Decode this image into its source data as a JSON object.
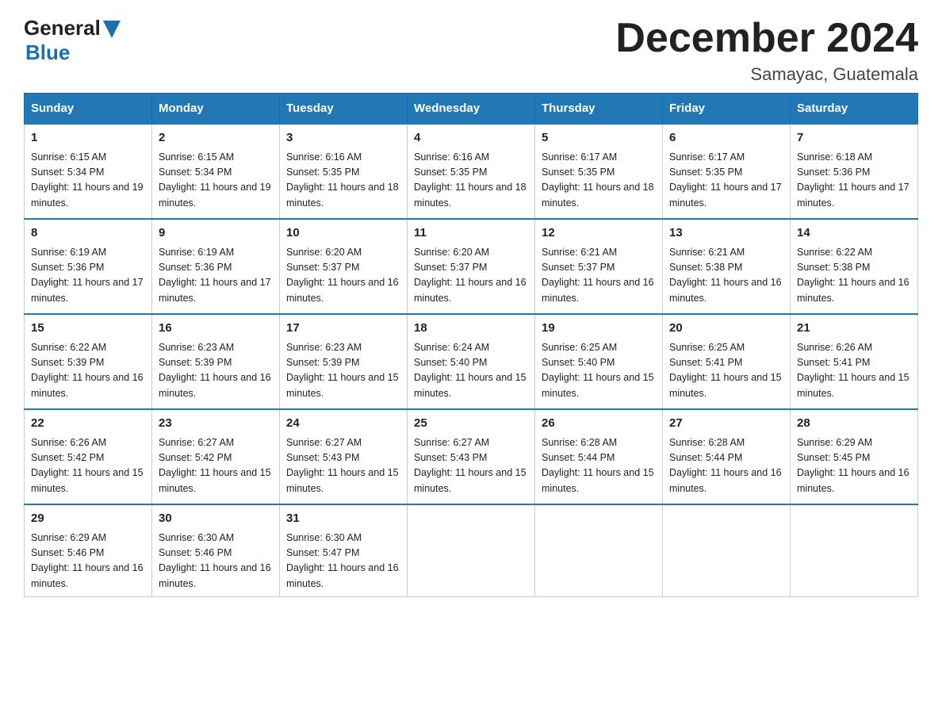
{
  "logo": {
    "text_general": "General",
    "triangle": "▶",
    "text_blue": "Blue"
  },
  "title": "December 2024",
  "subtitle": "Samayac, Guatemala",
  "headers": [
    "Sunday",
    "Monday",
    "Tuesday",
    "Wednesday",
    "Thursday",
    "Friday",
    "Saturday"
  ],
  "weeks": [
    [
      {
        "day": "1",
        "sunrise": "6:15 AM",
        "sunset": "5:34 PM",
        "daylight": "11 hours and 19 minutes."
      },
      {
        "day": "2",
        "sunrise": "6:15 AM",
        "sunset": "5:34 PM",
        "daylight": "11 hours and 19 minutes."
      },
      {
        "day": "3",
        "sunrise": "6:16 AM",
        "sunset": "5:35 PM",
        "daylight": "11 hours and 18 minutes."
      },
      {
        "day": "4",
        "sunrise": "6:16 AM",
        "sunset": "5:35 PM",
        "daylight": "11 hours and 18 minutes."
      },
      {
        "day": "5",
        "sunrise": "6:17 AM",
        "sunset": "5:35 PM",
        "daylight": "11 hours and 18 minutes."
      },
      {
        "day": "6",
        "sunrise": "6:17 AM",
        "sunset": "5:35 PM",
        "daylight": "11 hours and 17 minutes."
      },
      {
        "day": "7",
        "sunrise": "6:18 AM",
        "sunset": "5:36 PM",
        "daylight": "11 hours and 17 minutes."
      }
    ],
    [
      {
        "day": "8",
        "sunrise": "6:19 AM",
        "sunset": "5:36 PM",
        "daylight": "11 hours and 17 minutes."
      },
      {
        "day": "9",
        "sunrise": "6:19 AM",
        "sunset": "5:36 PM",
        "daylight": "11 hours and 17 minutes."
      },
      {
        "day": "10",
        "sunrise": "6:20 AM",
        "sunset": "5:37 PM",
        "daylight": "11 hours and 16 minutes."
      },
      {
        "day": "11",
        "sunrise": "6:20 AM",
        "sunset": "5:37 PM",
        "daylight": "11 hours and 16 minutes."
      },
      {
        "day": "12",
        "sunrise": "6:21 AM",
        "sunset": "5:37 PM",
        "daylight": "11 hours and 16 minutes."
      },
      {
        "day": "13",
        "sunrise": "6:21 AM",
        "sunset": "5:38 PM",
        "daylight": "11 hours and 16 minutes."
      },
      {
        "day": "14",
        "sunrise": "6:22 AM",
        "sunset": "5:38 PM",
        "daylight": "11 hours and 16 minutes."
      }
    ],
    [
      {
        "day": "15",
        "sunrise": "6:22 AM",
        "sunset": "5:39 PM",
        "daylight": "11 hours and 16 minutes."
      },
      {
        "day": "16",
        "sunrise": "6:23 AM",
        "sunset": "5:39 PM",
        "daylight": "11 hours and 16 minutes."
      },
      {
        "day": "17",
        "sunrise": "6:23 AM",
        "sunset": "5:39 PM",
        "daylight": "11 hours and 15 minutes."
      },
      {
        "day": "18",
        "sunrise": "6:24 AM",
        "sunset": "5:40 PM",
        "daylight": "11 hours and 15 minutes."
      },
      {
        "day": "19",
        "sunrise": "6:25 AM",
        "sunset": "5:40 PM",
        "daylight": "11 hours and 15 minutes."
      },
      {
        "day": "20",
        "sunrise": "6:25 AM",
        "sunset": "5:41 PM",
        "daylight": "11 hours and 15 minutes."
      },
      {
        "day": "21",
        "sunrise": "6:26 AM",
        "sunset": "5:41 PM",
        "daylight": "11 hours and 15 minutes."
      }
    ],
    [
      {
        "day": "22",
        "sunrise": "6:26 AM",
        "sunset": "5:42 PM",
        "daylight": "11 hours and 15 minutes."
      },
      {
        "day": "23",
        "sunrise": "6:27 AM",
        "sunset": "5:42 PM",
        "daylight": "11 hours and 15 minutes."
      },
      {
        "day": "24",
        "sunrise": "6:27 AM",
        "sunset": "5:43 PM",
        "daylight": "11 hours and 15 minutes."
      },
      {
        "day": "25",
        "sunrise": "6:27 AM",
        "sunset": "5:43 PM",
        "daylight": "11 hours and 15 minutes."
      },
      {
        "day": "26",
        "sunrise": "6:28 AM",
        "sunset": "5:44 PM",
        "daylight": "11 hours and 15 minutes."
      },
      {
        "day": "27",
        "sunrise": "6:28 AM",
        "sunset": "5:44 PM",
        "daylight": "11 hours and 16 minutes."
      },
      {
        "day": "28",
        "sunrise": "6:29 AM",
        "sunset": "5:45 PM",
        "daylight": "11 hours and 16 minutes."
      }
    ],
    [
      {
        "day": "29",
        "sunrise": "6:29 AM",
        "sunset": "5:46 PM",
        "daylight": "11 hours and 16 minutes."
      },
      {
        "day": "30",
        "sunrise": "6:30 AM",
        "sunset": "5:46 PM",
        "daylight": "11 hours and 16 minutes."
      },
      {
        "day": "31",
        "sunrise": "6:30 AM",
        "sunset": "5:47 PM",
        "daylight": "11 hours and 16 minutes."
      },
      null,
      null,
      null,
      null
    ]
  ]
}
